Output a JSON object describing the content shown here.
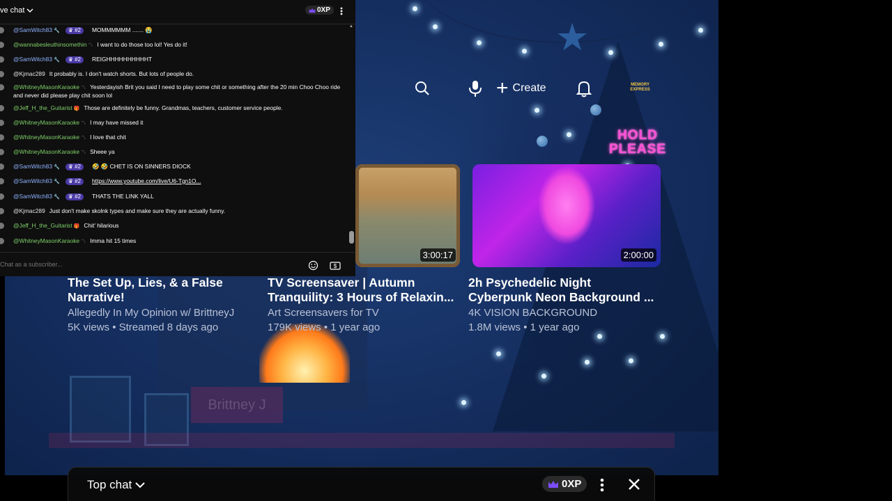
{
  "chat": {
    "title": "ve chat",
    "xp": "0XP",
    "input_placeholder": "Chat as a subscriber...",
    "messages": [
      {
        "author": "@SamWitch83",
        "author_color": "blue",
        "badge": "wrench",
        "rank": "#2",
        "text": "MOMMMMMM ....... 😭"
      },
      {
        "author": "@wannabesleuthinsomethin",
        "author_color": "green",
        "badge": "tag",
        "text": "I want to do those too lol! Yes do it!"
      },
      {
        "author": "@SamWitch83",
        "author_color": "blue",
        "badge": "wrench",
        "rank": "#2",
        "text": "REIGHHHHHHHHHHT"
      },
      {
        "author": "@Kjmac289",
        "author_color": "white",
        "text": "It probably is. I don't watch shorts. But lots of people do."
      },
      {
        "author": "@WhitneyMasonKaraoke",
        "author_color": "green",
        "badge": "tag",
        "text": "Yesterdayish Brit you said I need to play some chit or something after the 20 min Choo Choo ride and never did please play chit soon lol"
      },
      {
        "author": "@Jeff_H_the_Guitarist",
        "author_color": "green",
        "badge": "gift",
        "text": "Those are definitely be funny. Grandmas, teachers, customer service people."
      },
      {
        "author": "@WhitneyMasonKaraoke",
        "author_color": "green",
        "badge": "tag",
        "text": "I may have missed it"
      },
      {
        "author": "@WhitneyMasonKaraoke",
        "author_color": "green",
        "badge": "tag",
        "text": "I love that chit"
      },
      {
        "author": "@WhitneyMasonKaraoke",
        "author_color": "green",
        "badge": "tag",
        "text": "Sheee ya"
      },
      {
        "author": "@SamWitch83",
        "author_color": "blue",
        "badge": "wrench",
        "rank": "#2",
        "text": "🤣 🤣 CHET IS ON SINNERS DIOCK"
      },
      {
        "author": "@SamWitch83",
        "author_color": "blue",
        "badge": "wrench",
        "rank": "#2",
        "text": "https://www.youtube.com/live/U6-Tgn1O...",
        "is_link": true
      },
      {
        "author": "@SamWitch83",
        "author_color": "blue",
        "badge": "wrench",
        "rank": "#2",
        "text": "THATS THE LINK YALL"
      },
      {
        "author": "@Kjmac289",
        "author_color": "white",
        "text": "Just don't make skolnk types and make sure they are actually funny."
      },
      {
        "author": "@Jeff_H_the_Guitarist",
        "author_color": "green",
        "badge": "gift",
        "text": "Chit' hilarious"
      },
      {
        "author": "@WhitneyMasonKaraoke",
        "author_color": "green",
        "badge": "tag",
        "text": "Imma hit 15 times"
      }
    ]
  },
  "youtube_overlay": {
    "create_label": "Create",
    "logo_text": "MEMORY EXPRESS",
    "videos": [
      {
        "title": "The Set Up, Lies, & a False Narrative!",
        "channel": "Allegedly In My Opinion w/ BrittneyJ",
        "meta": "5K views • Streamed 8 days ago"
      },
      {
        "title": "TV Screensaver | Autumn Tranquility: 3 Hours of Relaxin...",
        "channel": "Art Screensavers for TV",
        "meta": "179K views • 1 year ago",
        "duration": "3:00:17"
      },
      {
        "title": "2h Psychedelic Night Cyberpunk Neon Background ...",
        "channel": "4K VISION BACKGROUND",
        "meta": "1.8M views • 1 year ago",
        "duration": "2:00:00"
      }
    ]
  },
  "stream": {
    "hold_please_line1": "HOLD",
    "hold_please_line2": "PLEASE",
    "stocking_name": "Brittney J"
  },
  "bottom_bar": {
    "title": "Top chat",
    "xp": "0XP"
  },
  "colors": {
    "accent_purple": "#7d4dff",
    "author_blue": "#8fb3ff",
    "author_green": "#7fd06a",
    "neon_pink": "#ff4fd8"
  }
}
